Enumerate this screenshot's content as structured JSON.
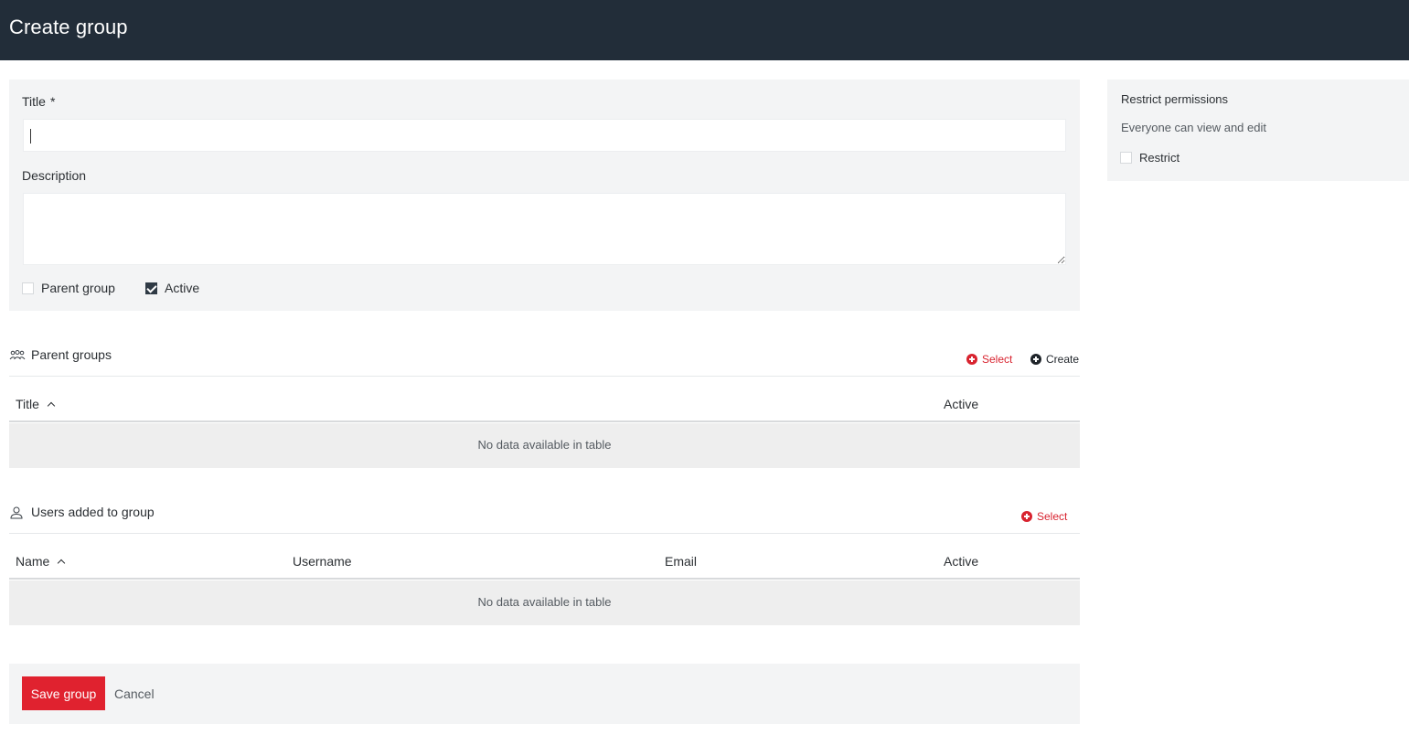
{
  "header": {
    "title": "Create group"
  },
  "form": {
    "title_label": "Title",
    "required_mark": "*",
    "title_value": "",
    "description_label": "Description",
    "description_value": "",
    "parent_group_label": "Parent group",
    "parent_group_checked": false,
    "active_label": "Active",
    "active_checked": true
  },
  "permissions": {
    "title": "Restrict permissions",
    "subtitle": "Everyone can view and edit",
    "restrict_label": "Restrict",
    "restrict_checked": false
  },
  "parent_groups": {
    "title": "Parent groups",
    "icon": "users-group-icon",
    "select_label": "Select",
    "create_label": "Create",
    "columns": [
      "Title",
      "Active"
    ],
    "sorted_column": "Title",
    "empty_text": "No data available in table"
  },
  "users": {
    "title": "Users added to group",
    "icon": "user-icon",
    "select_label": "Select",
    "columns": [
      "Name",
      "Username",
      "Email",
      "Active"
    ],
    "sorted_column": "Name",
    "empty_text": "No data available in table"
  },
  "footer": {
    "save_label": "Save group",
    "cancel_label": "Cancel"
  },
  "colors": {
    "header_bg": "#222d39",
    "accent_red": "#e0222f",
    "panel_bg": "#f3f4f5"
  }
}
